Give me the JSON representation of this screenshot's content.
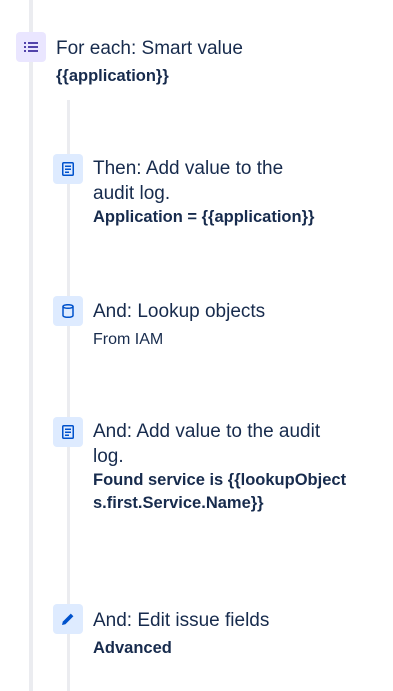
{
  "steps": {
    "for_each": {
      "icon": "list-icon",
      "title": "For each: Smart value",
      "subtitle": "{{application}}"
    },
    "audit_log_1": {
      "icon": "document-icon",
      "title": "Then: Add value to the audit log.",
      "subtitle": "Application = {{application}}"
    },
    "lookup": {
      "icon": "database-icon",
      "title": "And: Lookup objects",
      "subtitle": "From IAM"
    },
    "audit_log_2": {
      "icon": "document-icon",
      "title": "And: Add value to the audit log.",
      "subtitle": "Found service is {{lookupObjects.first.Service.Name}}"
    },
    "edit_issue": {
      "icon": "pencil-icon",
      "title": "And: Edit issue fields",
      "subtitle": "Advanced"
    }
  },
  "colors": {
    "purple_tile": "#eae6ff",
    "purple_icon": "#5243aa",
    "blue_tile": "#deebff",
    "blue_icon": "#0052cc",
    "rail": "#ebecf0",
    "text": "#172b4d"
  }
}
